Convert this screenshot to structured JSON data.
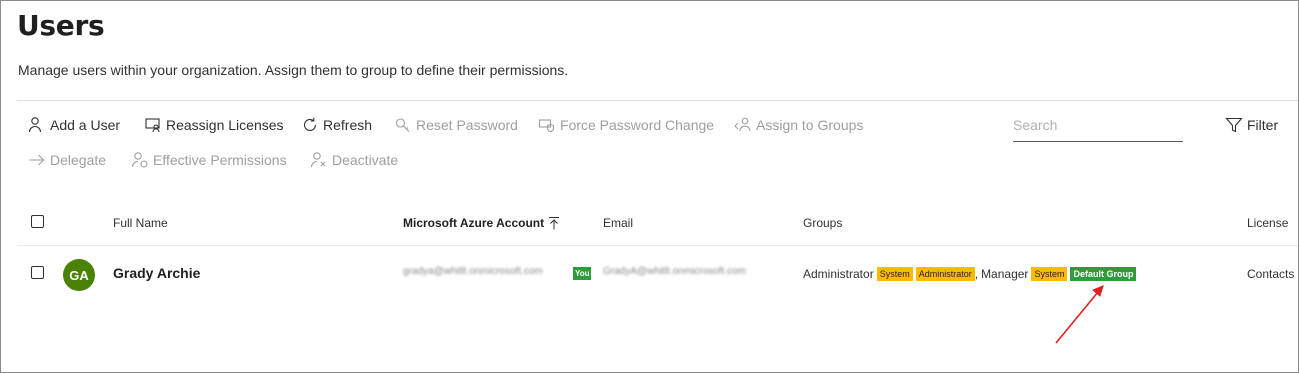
{
  "page": {
    "title": "Users",
    "subtitle": "Manage users within your organization. Assign them to group to define their permissions."
  },
  "toolbar": {
    "add_user": "Add a User",
    "reassign_licenses": "Reassign Licenses",
    "refresh": "Refresh",
    "reset_password": "Reset Password",
    "force_password_change": "Force Password Change",
    "assign_to_groups": "Assign to Groups",
    "filter": "Filter",
    "delegate": "Delegate",
    "effective_permissions": "Effective Permissions",
    "deactivate": "Deactivate",
    "icons": {
      "add_user": "person-add-icon",
      "reassign_licenses": "reassign-licenses-icon",
      "refresh": "refresh-icon",
      "reset_password": "key-icon",
      "force_password_change": "shield-icon",
      "assign_to_groups": "people-icon",
      "filter": "filter-icon",
      "delegate": "arrow-right-icon",
      "effective_permissions": "person-settings-icon",
      "deactivate": "person-remove-icon"
    }
  },
  "search": {
    "placeholder": "Search"
  },
  "table": {
    "headers": {
      "full_name": "Full Name",
      "azure_account": "Microsoft Azure Account",
      "email": "Email",
      "groups": "Groups",
      "license": "License"
    },
    "sort_icon": "sort-ascending-icon",
    "rows": [
      {
        "initials": "GA",
        "full_name": "Grady Archie",
        "azure_account": "gradya@whitlt.onmicrosoft.com",
        "you_badge": "You",
        "email": "GradyA@whitlt.onmicrosoft.com",
        "groups": [
          {
            "name": "Administrator",
            "tags": [
              "System",
              "Administrator"
            ]
          },
          {
            "name": "Manager",
            "tags": [
              "System",
              "Default Group"
            ]
          }
        ],
        "group_separator": ",",
        "license": "Contacts"
      }
    ]
  },
  "colors": {
    "avatar": "#498205",
    "tag_yellow": "#ffb900",
    "tag_green": "#2e9c3a",
    "annotation_arrow": "#e02020"
  },
  "annotation": {
    "icon": "red-arrow-icon"
  }
}
